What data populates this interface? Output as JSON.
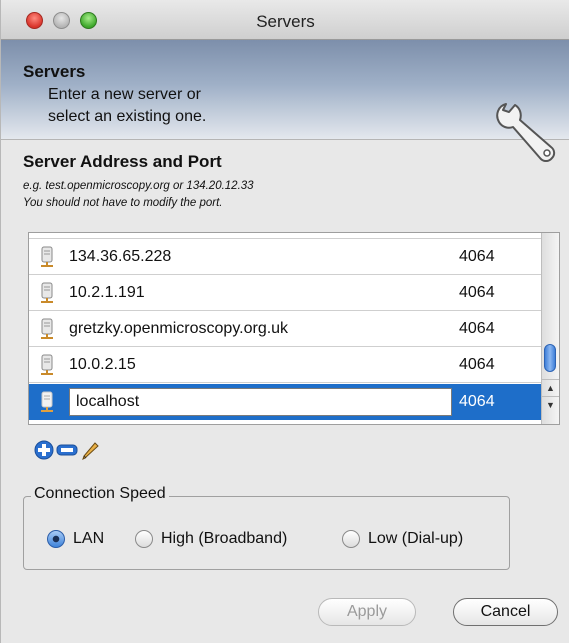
{
  "window": {
    "title": "Servers"
  },
  "banner": {
    "title": "Servers",
    "subtitle_line1": "Enter a new server or",
    "subtitle_line2": "select an existing one.",
    "icon": "wrench-icon"
  },
  "section": {
    "title": "Server Address and Port",
    "hint_line1": "e.g. test.openmicroscopy.org or 134.20.12.33",
    "hint_line2": "You should not have to modify the port."
  },
  "servers": {
    "rows": [
      {
        "host": "134.36.65.228",
        "port": "4064"
      },
      {
        "host": "10.2.1.191",
        "port": "4064"
      },
      {
        "host": "gretzky.openmicroscopy.org.uk",
        "port": "4064"
      },
      {
        "host": "10.0.2.15",
        "port": "4064"
      }
    ],
    "selected": {
      "host": "localhost",
      "port": "4064"
    }
  },
  "toolbar": {
    "add_icon": "plus-icon",
    "remove_icon": "minus-icon",
    "edit_icon": "pencil-icon"
  },
  "speed": {
    "legend": "Connection Speed",
    "options": [
      "LAN",
      "High (Broadband)",
      "Low (Dial-up)"
    ],
    "selected": "LAN"
  },
  "buttons": {
    "apply": "Apply",
    "cancel": "Cancel"
  },
  "colors": {
    "selection": "#1e6ec9",
    "banner_top": "#7d8fab"
  }
}
